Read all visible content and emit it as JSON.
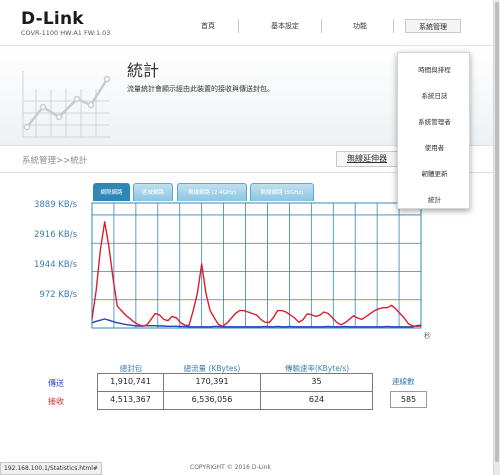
{
  "header": {
    "logo": "D-Link",
    "model": "COVR-1100 HW:A1 FW:1.03",
    "nav": [
      "首頁",
      "基本設定",
      "功能",
      "系統管理"
    ]
  },
  "page": {
    "title": "統計",
    "description": "流量統計會顯示經由此裝置的接收與傳送封包。"
  },
  "breadcrumb": {
    "path": "系統管理>>統計",
    "link": "無線延伸器"
  },
  "menu": {
    "items": [
      "時間與排程",
      "系統日誌",
      "系統管理者",
      "使用者",
      "韌體更新",
      "統計"
    ]
  },
  "chart": {
    "tabs": [
      "網際網路",
      "區域網路",
      "無線網路 (2.4GHz)",
      "無線網路 (5GHz)"
    ],
    "y_ticks": [
      "3889 KB/s",
      "2916 KB/s",
      "1944 KB/s",
      "972 KB/s"
    ],
    "unit": "秒"
  },
  "chart_data": {
    "type": "line",
    "ylabel": "",
    "xlabel": "秒",
    "y_ticks": [
      972,
      1944,
      2916,
      3889
    ],
    "ylim": [
      0,
      4300
    ],
    "x": [
      0,
      1,
      2,
      3,
      4,
      5,
      6,
      7,
      8,
      9,
      10,
      11,
      12,
      13,
      14,
      15,
      16,
      17,
      18,
      19,
      20,
      21,
      22,
      23,
      24,
      25,
      26,
      27,
      28,
      29,
      30,
      31,
      32,
      33,
      34,
      35,
      36,
      37,
      38,
      39,
      40,
      41,
      42,
      43,
      44,
      45,
      46,
      47,
      48,
      49,
      50,
      51,
      52,
      53,
      54,
      55,
      56,
      57,
      58,
      59,
      60,
      61,
      62,
      63,
      64,
      65,
      66,
      67,
      68,
      69,
      70,
      71,
      72,
      73,
      74,
      75,
      76,
      77,
      78
    ],
    "series": [
      {
        "name": "傳送",
        "color": "#2840b8",
        "values": [
          180,
          230,
          270,
          310,
          270,
          220,
          180,
          150,
          120,
          100,
          80,
          70,
          70,
          80,
          80,
          80,
          70,
          70,
          60,
          60,
          60,
          50,
          50,
          40,
          40,
          40,
          40,
          40,
          40,
          50,
          50,
          40,
          40,
          40,
          40,
          40,
          40,
          40,
          40,
          40,
          40,
          50,
          40,
          40,
          50,
          40,
          40,
          50,
          40,
          40,
          40,
          40,
          40,
          40,
          40,
          40,
          50,
          40,
          40,
          40,
          50,
          40,
          40,
          40,
          40,
          40,
          40,
          40,
          40,
          40,
          50,
          40,
          40,
          40,
          40,
          40,
          40,
          80,
          100
        ]
      },
      {
        "name": "接收",
        "color": "#d8202c",
        "values": [
          300,
          1300,
          2700,
          3650,
          2800,
          1700,
          750,
          600,
          440,
          320,
          200,
          120,
          70,
          100,
          300,
          500,
          450,
          300,
          250,
          400,
          350,
          180,
          100,
          90,
          600,
          1200,
          2200,
          1200,
          600,
          350,
          120,
          60,
          170,
          330,
          500,
          600,
          600,
          550,
          500,
          450,
          300,
          200,
          190,
          360,
          600,
          600,
          550,
          450,
          350,
          200,
          280,
          480,
          460,
          400,
          440,
          550,
          500,
          350,
          200,
          110,
          180,
          300,
          420,
          340,
          300,
          400,
          500,
          600,
          660,
          700,
          700,
          780,
          660,
          500,
          350,
          150,
          70,
          60,
          70
        ]
      }
    ]
  },
  "stats": {
    "headers": [
      "總封包",
      "總流量 (KBytes)",
      "傳輸速率(KByte/s)"
    ],
    "tx_label": "傳送",
    "rx_label": "接收",
    "tx": [
      "1,910,741",
      "170,391",
      "35"
    ],
    "rx": [
      "4,513,367",
      "6,536,056",
      "624"
    ],
    "reset_label": "連線數",
    "reset_value": "585"
  },
  "footer": {
    "copyright": "COPYRIGHT © 2016 D-Link",
    "status_url": "192.168.100.1/Statistics.html#"
  },
  "colors": {
    "accent": "#2d88b6",
    "tx": "#2840b8",
    "rx": "#d8202c"
  }
}
